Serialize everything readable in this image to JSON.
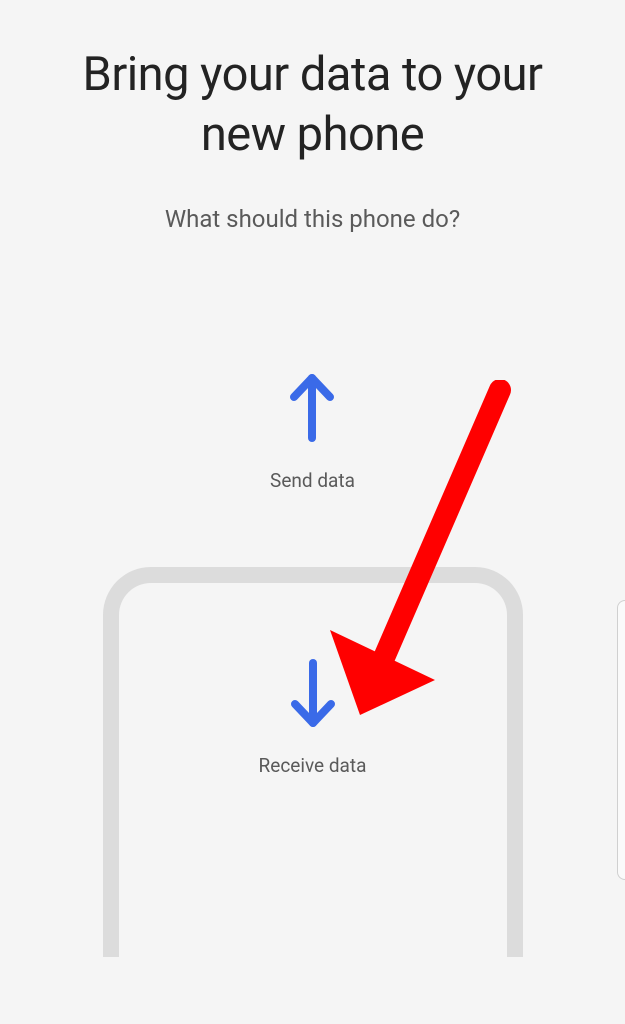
{
  "title": "Bring your data to your new phone",
  "subtitle": "What should this phone do?",
  "options": {
    "send": {
      "label": "Send data",
      "icon": "arrow-up-icon"
    },
    "receive": {
      "label": "Receive data",
      "icon": "arrow-down-icon"
    }
  },
  "colors": {
    "arrow": "#3a6ae8",
    "annotation": "#ff0000"
  }
}
